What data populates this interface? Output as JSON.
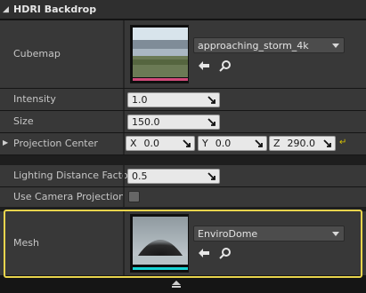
{
  "header": {
    "title": "HDRI Backdrop"
  },
  "cubemap": {
    "label": "Cubemap",
    "asset": "approaching_storm_4k"
  },
  "intensity": {
    "label": "Intensity",
    "value": "1.0"
  },
  "size": {
    "label": "Size",
    "value": "150.0"
  },
  "projection_center": {
    "label": "Projection Center",
    "x_axis": "X",
    "x": "0.0",
    "y_axis": "Y",
    "y": "0.0",
    "z_axis": "Z",
    "z": "290.0"
  },
  "lighting_distance_factor": {
    "label": "Lighting Distance Factor",
    "value": "0.5"
  },
  "use_camera_projection": {
    "label": "Use Camera Projection",
    "checked": false
  },
  "mesh": {
    "label": "Mesh",
    "asset": "EnviroDome"
  },
  "colors": {
    "cubemap_bar": "#d04a7a",
    "mesh_bar": "#18d6d6",
    "highlight": "#e8d44d",
    "reset": "#d9c400"
  }
}
